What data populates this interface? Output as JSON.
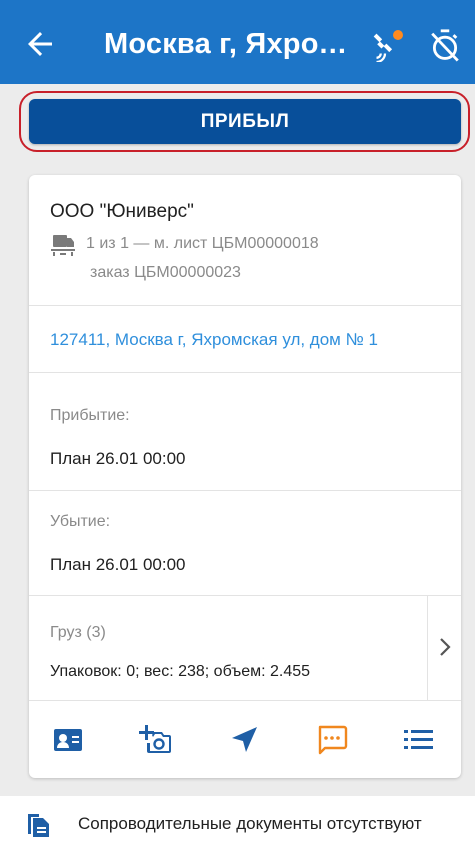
{
  "header": {
    "title": "Москва г, Яхромс...",
    "back_icon": "arrow-left-icon",
    "gps_icon": "satellite-icon",
    "gps_status_color": "#ff8a1f",
    "timer_icon": "timer-off-icon"
  },
  "arrived_button": {
    "label": "ПРИБЫЛ"
  },
  "order": {
    "company": "ООО \"Юниверс\"",
    "route_line1": "1 из 1 —  м. лист ЦБМ00000018",
    "route_line2": "заказ ЦБМ00000023",
    "address": "127411, Москва г, Яхромская ул, дом № 1",
    "arrival_label": "Прибытие:",
    "arrival_plan": "План   26.01 00:00",
    "departure_label": "Убытие:",
    "departure_plan": "План   26.01 00:00",
    "cargo_label": "Груз  (3)",
    "cargo_details": "Упаковок: 0; вес: 238; объем: 2.455"
  },
  "actions": [
    {
      "icon": "contact-card-icon"
    },
    {
      "icon": "add-photo-icon"
    },
    {
      "icon": "navigation-icon"
    },
    {
      "icon": "chat-icon",
      "color": "#f0871e"
    },
    {
      "icon": "list-icon"
    }
  ],
  "footer": {
    "documents_text": "Сопроводительные документы отсутствуют",
    "icon": "documents-icon"
  },
  "colors": {
    "appbar": "#1d75c7",
    "primary_button": "#084f9a",
    "highlight_border": "#c8202a",
    "link": "#2f8fdc",
    "icon_blue": "#1f5fa6",
    "icon_orange": "#f0871e"
  }
}
